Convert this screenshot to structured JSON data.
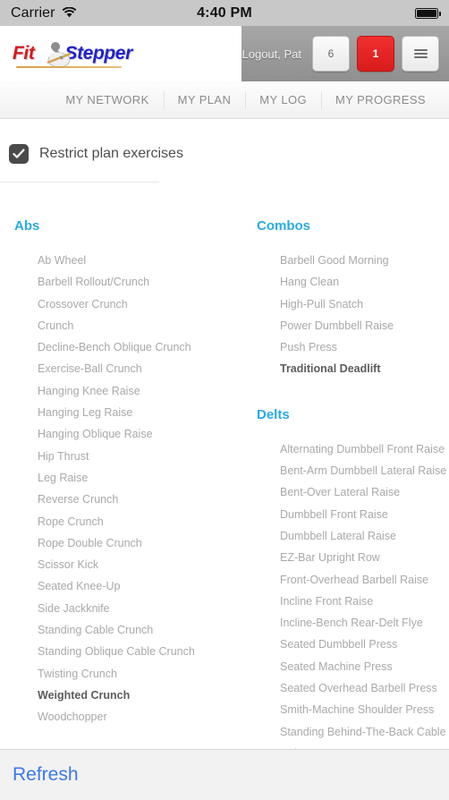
{
  "status_bar": {
    "carrier": "Carrier",
    "wifi_icon": "wifi-icon",
    "time": "4:40 PM",
    "battery_icon": "battery-full-icon"
  },
  "header": {
    "logo_first": "Fit",
    "logo_second": "Stepper",
    "logo_mark_icon": "stepper-figure-icon",
    "logout_label": "Logout, Pat",
    "buttons": [
      {
        "name": "notifications-button",
        "label": "6",
        "style": "light"
      },
      {
        "name": "alerts-button",
        "label": "1",
        "style": "red"
      },
      {
        "name": "menu-button",
        "label": "",
        "style": "light",
        "icon": "hamburger-icon"
      }
    ],
    "accent_red": "#d81b1b"
  },
  "nav": {
    "tabs": [
      {
        "label": "MY NETWORK"
      },
      {
        "label": "MY PLAN"
      },
      {
        "label": "MY LOG"
      },
      {
        "label": "MY PROGRESS"
      }
    ]
  },
  "main": {
    "restrict_checkbox_label": "Restrict plan exercises",
    "restrict_checked": true,
    "heading_color": "#29abe2",
    "columns": [
      {
        "groups": [
          {
            "title": "Abs",
            "items": [
              {
                "label": "Ab Wheel",
                "selected": false
              },
              {
                "label": "Barbell Rollout/Crunch",
                "selected": false
              },
              {
                "label": "Crossover Crunch",
                "selected": false
              },
              {
                "label": "Crunch",
                "selected": false
              },
              {
                "label": "Decline-Bench Oblique Crunch",
                "selected": false
              },
              {
                "label": "Exercise-Ball Crunch",
                "selected": false
              },
              {
                "label": "Hanging Knee Raise",
                "selected": false
              },
              {
                "label": "Hanging Leg Raise",
                "selected": false
              },
              {
                "label": "Hanging Oblique Raise",
                "selected": false
              },
              {
                "label": "Hip Thrust",
                "selected": false
              },
              {
                "label": "Leg Raise",
                "selected": false
              },
              {
                "label": "Reverse Crunch",
                "selected": false
              },
              {
                "label": "Rope Crunch",
                "selected": false
              },
              {
                "label": "Rope Double Crunch",
                "selected": false
              },
              {
                "label": "Scissor Kick",
                "selected": false
              },
              {
                "label": "Seated Knee-Up",
                "selected": false
              },
              {
                "label": "Side Jackknife",
                "selected": false
              },
              {
                "label": "Standing Cable Crunch",
                "selected": false
              },
              {
                "label": "Standing Oblique Cable Crunch",
                "selected": false
              },
              {
                "label": "Twisting Crunch",
                "selected": false
              },
              {
                "label": "Weighted Crunch",
                "selected": true
              },
              {
                "label": "Woodchopper",
                "selected": false
              }
            ]
          }
        ]
      },
      {
        "groups": [
          {
            "title": "Combos",
            "items": [
              {
                "label": "Barbell Good Morning",
                "selected": false
              },
              {
                "label": "Hang Clean",
                "selected": false
              },
              {
                "label": "High-Pull Snatch",
                "selected": false
              },
              {
                "label": "Power Dumbbell Raise",
                "selected": false
              },
              {
                "label": "Push Press",
                "selected": false
              },
              {
                "label": "Traditional Deadlift",
                "selected": true
              }
            ]
          },
          {
            "title": "Delts",
            "items": [
              {
                "label": "Alternating Dumbbell Front Raise",
                "selected": false
              },
              {
                "label": "Bent-Arm Dumbbell Lateral Raise",
                "selected": false
              },
              {
                "label": "Bent-Over Lateral Raise",
                "selected": false
              },
              {
                "label": "Dumbbell Front Raise",
                "selected": false
              },
              {
                "label": "Dumbbell Lateral Raise",
                "selected": false
              },
              {
                "label": "EZ-Bar Upright Row",
                "selected": false
              },
              {
                "label": "Front-Overhead Barbell Raise",
                "selected": false
              },
              {
                "label": "Incline Front Raise",
                "selected": false
              },
              {
                "label": "Incline-Bench Rear-Delt Flye",
                "selected": false
              },
              {
                "label": "Seated Dumbbell Press",
                "selected": false
              },
              {
                "label": "Seated Machine Press",
                "selected": false
              },
              {
                "label": "Seated Overhead Barbell Press",
                "selected": false
              },
              {
                "label": "Smith-Machine Shoulder Press",
                "selected": false
              },
              {
                "label": "Standing Behind-The-Back Cable Raise",
                "selected": false,
                "wrap": true
              }
            ]
          }
        ]
      }
    ]
  },
  "toolbar": {
    "refresh_label": "Refresh",
    "link_color": "#3b79e8"
  }
}
